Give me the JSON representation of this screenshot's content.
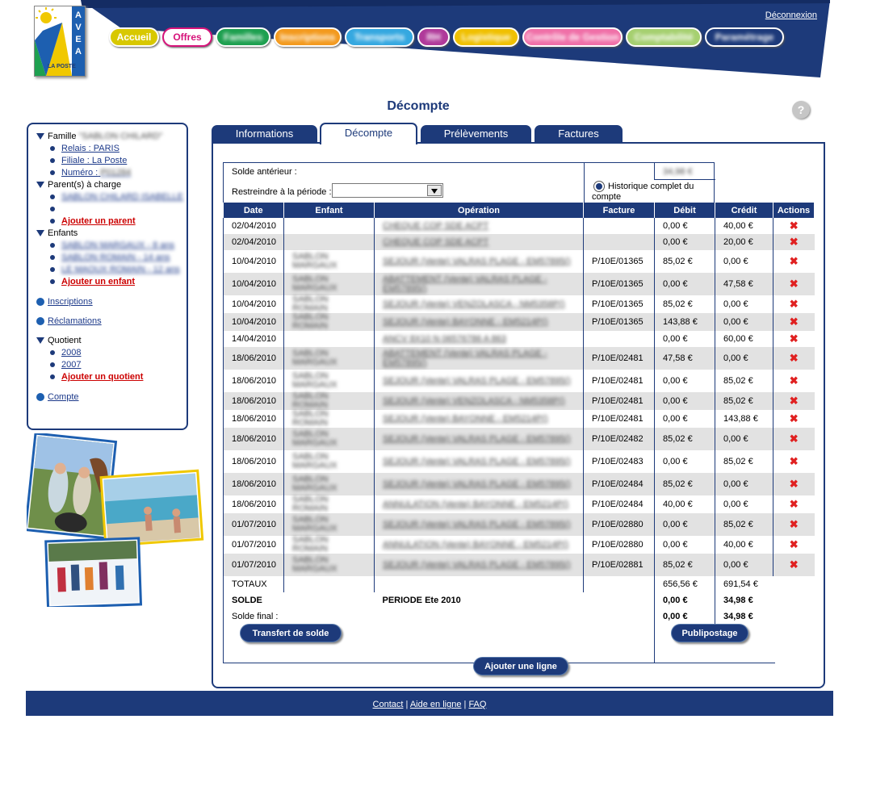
{
  "header": {
    "logo_text": "AVEA",
    "logo_sub": "LA POSTE",
    "logout": "Déconnexion",
    "nav": [
      {
        "label": "Accueil",
        "color": "#d8c800",
        "text_color": "#ffffff"
      },
      {
        "label": "Offres",
        "color": "#ffffff",
        "text_color": "#d6127a",
        "border": "#d6127a"
      },
      {
        "label": "Familles",
        "color": "#1ea050",
        "text_color": "#ffffff"
      },
      {
        "label": "Inscriptions",
        "color": "#f39a1e",
        "text_color": "#ffffff"
      },
      {
        "label": "Transports",
        "color": "#35a8e0",
        "text_color": "#ffffff"
      },
      {
        "label": "RH",
        "color": "#b03a9a",
        "text_color": "#ffffff"
      },
      {
        "label": "Logistique",
        "color": "#f0c000",
        "text_color": "#ffffff"
      },
      {
        "label": "Contrôle de Gestion",
        "color": "#f070a8",
        "text_color": "#ffffff"
      },
      {
        "label": "Comptabilité",
        "color": "#a6d070",
        "text_color": "#ffffff"
      },
      {
        "label": "Paramétrage",
        "color": "#1d3a7a",
        "text_color": "#ffffff"
      }
    ]
  },
  "page_title": "Décompte",
  "sidebar": {
    "famille_label": "Famille",
    "famille_name": "\"SABLON CHILARD\"",
    "relais": "Relais : PARIS",
    "filiale": "Filiale : La Poste",
    "numero_label": "Numéro :",
    "numero_value": "P01284",
    "parents_label": "Parent(s) à charge",
    "parent1": "SABLON CHILARD ISABELLE",
    "add_parent": "Ajouter un parent",
    "enfants_label": "Enfants",
    "enfant1": "SABLON MARGAUX - 8 ans",
    "enfant2": "SABLON ROMAIN - 14 ans",
    "enfant3": "LE MAOUX ROMAIN - 12 ans",
    "add_enfant": "Ajouter un enfant",
    "inscriptions": "Inscriptions",
    "reclamations": "Réclamations",
    "quotient_label": "Quotient",
    "q1": "2008",
    "q2": "2007",
    "add_quotient": "Ajouter un quotient",
    "compte": "Compte"
  },
  "tabs": [
    "Informations",
    "Décompte",
    "Prélèvements",
    "Factures"
  ],
  "summary": {
    "solde_anterieur_label": "Solde antérieur :",
    "solde_anterieur_value": "34,98 €",
    "periode_label": "Restreindre à la période :",
    "historique_label": "Historique complet du compte"
  },
  "table": {
    "headers": [
      "Date",
      "Enfant",
      "Opération",
      "Facture",
      "Débit",
      "Crédit",
      "Actions"
    ],
    "rows": [
      {
        "date": "02/04/2010",
        "enfant": "",
        "op": "CHEQUE COP SDE ACPT",
        "facture": "",
        "debit": "0,00 €",
        "credit": "40,00 €",
        "tall": false
      },
      {
        "date": "02/04/2010",
        "enfant": "",
        "op": "CHEQUE COP SDE ACPT",
        "facture": "",
        "debit": "0,00 €",
        "credit": "20,00 €",
        "tall": false
      },
      {
        "date": "10/04/2010",
        "enfant": "SABLON MARGAUX",
        "op": "SEJOUR (Vente) VALRAS PLAGE - EM57895()",
        "facture": "P/10E/01365",
        "debit": "85,02 €",
        "credit": "0,00 €",
        "tall": true
      },
      {
        "date": "10/04/2010",
        "enfant": "SABLON MARGAUX",
        "op": "ABATTEMENT (Vente) VALRAS PLAGE - EM57895()",
        "facture": "P/10E/01365",
        "debit": "0,00 €",
        "credit": "47,58 €",
        "tall": true
      },
      {
        "date": "10/04/2010",
        "enfant": "SABLON ROMAIN",
        "op": "SEJOUR (Vente) VENZOLASCA - NM5358P()",
        "facture": "P/10E/01365",
        "debit": "85,02 €",
        "credit": "0,00 €",
        "tall": false
      },
      {
        "date": "10/04/2010",
        "enfant": "SABLON ROMAIN",
        "op": "SEJOUR (Vente) BAYONNE - EM5214P()",
        "facture": "P/10E/01365",
        "debit": "143,88 €",
        "credit": "0,00 €",
        "tall": false
      },
      {
        "date": "14/04/2010",
        "enfant": "",
        "op": "ANCV 8X10 N 06576786 A 863",
        "facture": "",
        "debit": "0,00 €",
        "credit": "60,00 €",
        "tall": false
      },
      {
        "date": "18/06/2010",
        "enfant": "SABLON MARGAUX",
        "op": "ABATTEMENT (Vente) VALRAS PLAGE - EM57895()",
        "facture": "P/10E/02481",
        "debit": "47,58 €",
        "credit": "0,00 €",
        "tall": true
      },
      {
        "date": "18/06/2010",
        "enfant": "SABLON MARGAUX",
        "op": "SEJOUR (Vente) VALRAS PLAGE - EM57895()",
        "facture": "P/10E/02481",
        "debit": "0,00 €",
        "credit": "85,02 €",
        "tall": true
      },
      {
        "date": "18/06/2010",
        "enfant": "SABLON ROMAIN",
        "op": "SEJOUR (Vente) VENZOLASCA - NM5358P()",
        "facture": "P/10E/02481",
        "debit": "0,00 €",
        "credit": "85,02 €",
        "tall": false
      },
      {
        "date": "18/06/2010",
        "enfant": "SABLON ROMAIN",
        "op": "SEJOUR (Vente) BAYONNE - EM5214P()",
        "facture": "P/10E/02481",
        "debit": "0,00 €",
        "credit": "143,88 €",
        "tall": false
      },
      {
        "date": "18/06/2010",
        "enfant": "SABLON MARGAUX",
        "op": "SEJOUR (Vente) VALRAS PLAGE - EM57895()",
        "facture": "P/10E/02482",
        "debit": "85,02 €",
        "credit": "0,00 €",
        "tall": true
      },
      {
        "date": "18/06/2010",
        "enfant": "SABLON MARGAUX",
        "op": "SEJOUR (Vente) VALRAS PLAGE - EM57895()",
        "facture": "P/10E/02483",
        "debit": "0,00 €",
        "credit": "85,02 €",
        "tall": true
      },
      {
        "date": "18/06/2010",
        "enfant": "SABLON MARGAUX",
        "op": "SEJOUR (Vente) VALRAS PLAGE - EM57895()",
        "facture": "P/10E/02484",
        "debit": "85,02 €",
        "credit": "0,00 €",
        "tall": true
      },
      {
        "date": "18/06/2010",
        "enfant": "SABLON ROMAIN",
        "op": "ANNULATION (Vente) BAYONNE - EM5214P()",
        "facture": "P/10E/02484",
        "debit": "40,00 €",
        "credit": "0,00 €",
        "tall": false
      },
      {
        "date": "01/07/2010",
        "enfant": "SABLON MARGAUX",
        "op": "SEJOUR (Vente) VALRAS PLAGE - EM57895()",
        "facture": "P/10E/02880",
        "debit": "0,00 €",
        "credit": "85,02 €",
        "tall": true
      },
      {
        "date": "01/07/2010",
        "enfant": "SABLON ROMAIN",
        "op": "ANNULATION (Vente) BAYONNE - EM5214P()",
        "facture": "P/10E/02880",
        "debit": "0,00 €",
        "credit": "40,00 €",
        "tall": false
      },
      {
        "date": "01/07/2010",
        "enfant": "SABLON MARGAUX",
        "op": "SEJOUR (Vente) VALRAS PLAGE - EM57895()",
        "facture": "P/10E/02881",
        "debit": "85,02 €",
        "credit": "0,00 €",
        "tall": true
      }
    ],
    "totaux_label": "TOTAUX",
    "totaux_debit": "656,56 €",
    "totaux_credit": "691,54 €",
    "solde_label": "SOLDE",
    "periode_text": "PERIODE Ete 2010",
    "solde_debit": "0,00 €",
    "solde_credit": "34,98 €",
    "solde_final_label": "Solde final :",
    "solde_final_debit": "0,00 €",
    "solde_final_credit": "34,98 €"
  },
  "buttons": {
    "transfert": "Transfert de solde",
    "publipostage": "Publipostage",
    "ajouter_ligne": "Ajouter une ligne"
  },
  "footer": {
    "contact": "Contact",
    "aide": "Aide en ligne",
    "faq": "FAQ",
    "sep": "|"
  }
}
